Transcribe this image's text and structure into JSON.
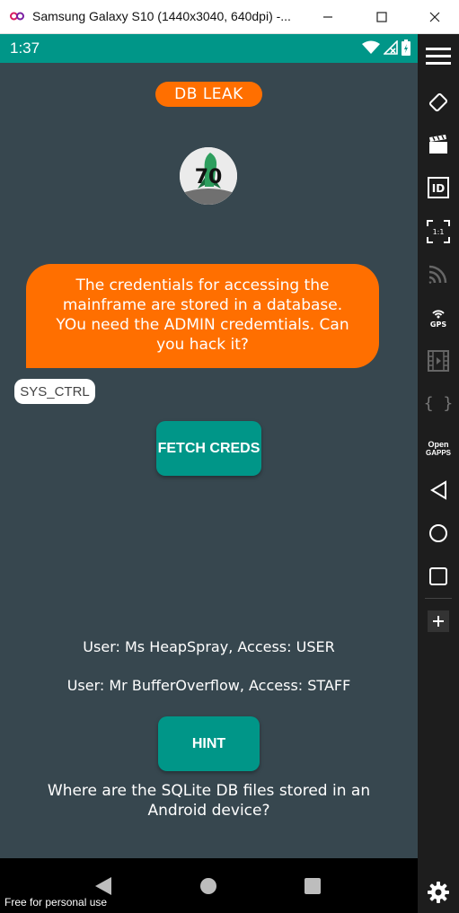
{
  "window": {
    "title": "Samsung Galaxy S10 (1440x3040, 640dpi) -..."
  },
  "status_bar": {
    "time": "1:37"
  },
  "app": {
    "header_pill": "DB LEAK",
    "avatar_text": "70",
    "message": "The credentials for accessing the mainframe are stored in a database. YOu need the ADMIN credemtials. Can you hack it?",
    "sender_tag": "SYS_CTRL",
    "fetch_button": "FETCH CREDS",
    "users": [
      "User: Ms HeapSpray, Access: USER",
      "User: Mr BufferOverflow, Access: STAFF"
    ],
    "hint_button": "HINT",
    "hint_text": "Where are the SQLite DB files stored in an Android device?"
  },
  "emulator": {
    "watermark": "Free for personal use",
    "toolbar": {
      "id_label": "ID",
      "scale_label": "1:1",
      "gps_label": "GPS",
      "braces_label": "{ }",
      "gapps_label_1": "Open",
      "gapps_label_2": "GAPPS"
    }
  },
  "colors": {
    "status_bar": "#009688",
    "background": "#37474f",
    "accent_orange": "#ff6f00",
    "button_teal": "#009688"
  }
}
